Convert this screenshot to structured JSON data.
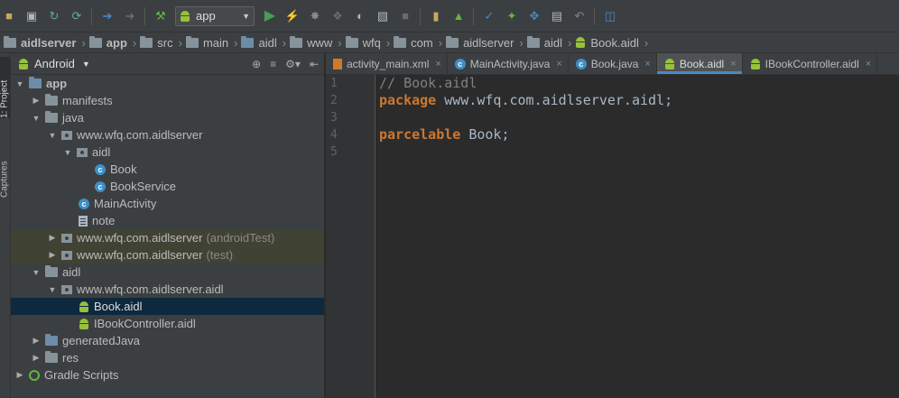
{
  "toolbar": {
    "run_config": "app",
    "colors": {
      "run": "#499c54",
      "accent": "#4a88c7"
    }
  },
  "breadcrumb": [
    "aidlserver",
    "app",
    "src",
    "main",
    "aidl",
    "www",
    "wfq",
    "com",
    "aidlserver",
    "aidl",
    "Book.aidl"
  ],
  "side_tabs": {
    "project": "1: Project",
    "captures": "Captures"
  },
  "project_panel": {
    "view": "Android"
  },
  "tree": [
    {
      "label": "app",
      "suffix": ""
    },
    {
      "label": "manifests",
      "suffix": ""
    },
    {
      "label": "java",
      "suffix": ""
    },
    {
      "label": "www.wfq.com.aidlserver",
      "suffix": ""
    },
    {
      "label": "aidl",
      "suffix": ""
    },
    {
      "label": "Book",
      "suffix": ""
    },
    {
      "label": "BookService",
      "suffix": ""
    },
    {
      "label": "MainActivity",
      "suffix": ""
    },
    {
      "label": "note",
      "suffix": ""
    },
    {
      "label": "www.wfq.com.aidlserver",
      "suffix": "(androidTest)"
    },
    {
      "label": "www.wfq.com.aidlserver",
      "suffix": "(test)"
    },
    {
      "label": "aidl",
      "suffix": ""
    },
    {
      "label": "www.wfq.com.aidlserver.aidl",
      "suffix": ""
    },
    {
      "label": "Book.aidl",
      "suffix": ""
    },
    {
      "label": "IBookController.aidl",
      "suffix": ""
    },
    {
      "label": "generatedJava",
      "suffix": ""
    },
    {
      "label": "res",
      "suffix": ""
    },
    {
      "label": "Gradle Scripts",
      "suffix": ""
    }
  ],
  "tabs": [
    {
      "label": "activity_main.xml"
    },
    {
      "label": "MainActivity.java"
    },
    {
      "label": "Book.java"
    },
    {
      "label": "Book.aidl"
    },
    {
      "label": "IBookController.aidl"
    }
  ],
  "editor": {
    "line_numbers": [
      "1",
      "2",
      "3",
      "4",
      "5"
    ],
    "line1_comment": "// Book.aidl",
    "line2_kw": "package",
    "line2_rest": " www.wfq.com.aidlserver.aidl;",
    "line4_kw": "parcelable",
    "line4_rest": " Book;"
  }
}
